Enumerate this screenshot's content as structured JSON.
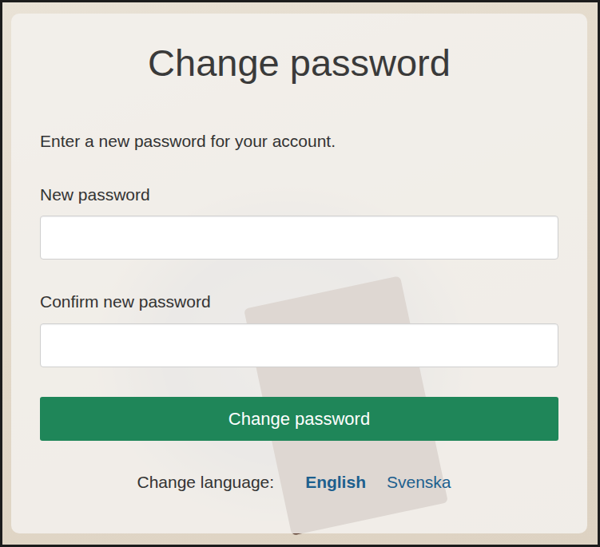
{
  "title": "Change password",
  "intro": "Enter a new password for your account.",
  "fields": [
    {
      "label": "New password",
      "value": ""
    },
    {
      "label": "Confirm new password",
      "value": ""
    }
  ],
  "button": "Change password",
  "language": {
    "label": "Change language:",
    "options": [
      {
        "label": "English",
        "selected": true
      },
      {
        "label": "Svenska",
        "selected": false
      }
    ]
  }
}
